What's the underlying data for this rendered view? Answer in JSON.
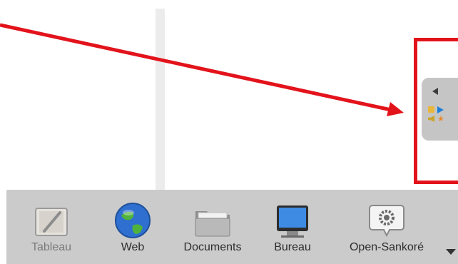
{
  "dock": {
    "items": [
      {
        "id": "tableau",
        "label": "Tableau",
        "icon": "board-pen-icon",
        "disabled": true
      },
      {
        "id": "web",
        "label": "Web",
        "icon": "globe-icon",
        "disabled": false
      },
      {
        "id": "documents",
        "label": "Documents",
        "icon": "folder-icon",
        "disabled": false
      },
      {
        "id": "bureau",
        "label": "Bureau",
        "icon": "desktop-monitor-icon",
        "disabled": false
      },
      {
        "id": "open-sankore",
        "label": "Open-Sankoré",
        "icon": "gear-speech-icon",
        "disabled": false
      }
    ],
    "more_icon": "caret-down-icon"
  },
  "side_panel": {
    "collapse_icon": "collapse-left-icon",
    "mini_icons": [
      "folder-icon",
      "play-icon",
      "speaker-icon",
      "star-icon"
    ]
  },
  "colors": {
    "annotation": "#e3131b",
    "dock_bg": "#cbcbcb",
    "panel_bg": "#c5c5c5"
  }
}
